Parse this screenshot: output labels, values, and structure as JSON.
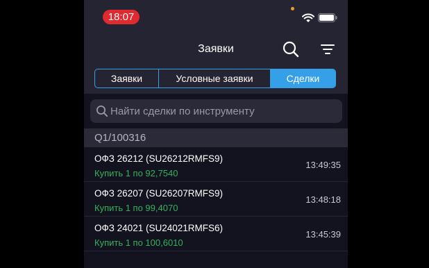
{
  "status_bar": {
    "time": "18:07",
    "icons": [
      "orange-dot",
      "wifi-icon",
      "battery-icon"
    ]
  },
  "nav": {
    "title": "Заявки",
    "tabs": [
      {
        "label": "Заявки",
        "selected": false
      },
      {
        "label": "Условные заявки",
        "selected": false
      },
      {
        "label": "Сделки",
        "selected": true
      }
    ]
  },
  "search": {
    "placeholder": "Найти сделки по инструменту",
    "value": ""
  },
  "section": {
    "title": "Q1/100316"
  },
  "trades": [
    {
      "name": "ОФЗ 26212 (SU26212RMFS9)",
      "action": "Купить 1 по 92,7540",
      "time": "13:49:35"
    },
    {
      "name": "ОФЗ 26207 (SU26207RMFS9)",
      "action": "Купить 1 по 99,4070",
      "time": "13:48:18"
    },
    {
      "name": "ОФЗ 24021 (SU24021RMFS6)",
      "action": "Купить 1 по 100,6010",
      "time": "13:45:39"
    }
  ],
  "colors": {
    "accent": "#35a0e8",
    "buy": "#31b25a",
    "time_pill": "#e02a2f",
    "background": "#131320",
    "bar": "#242432"
  }
}
